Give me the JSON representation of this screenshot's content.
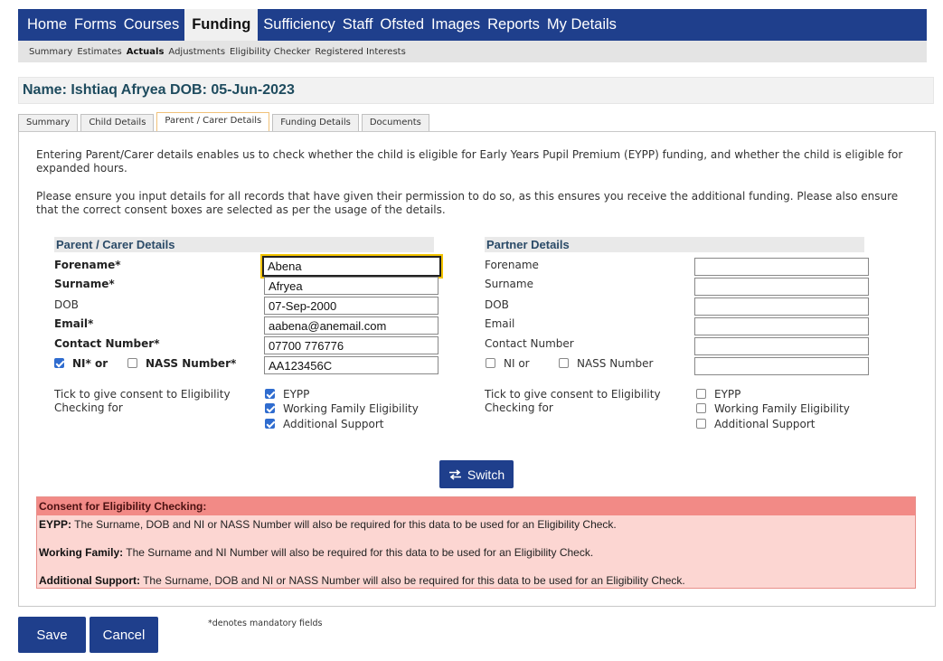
{
  "topnav": [
    "Home",
    "Forms",
    "Courses",
    "Funding",
    "Sufficiency",
    "Staff",
    "Ofsted",
    "Images",
    "Reports",
    "My Details"
  ],
  "subnav": [
    "Summary",
    "Estimates",
    "Actuals",
    "Adjustments",
    "Eligibility Checker",
    "Registered Interests"
  ],
  "name_bar": "Name: Ishtiaq Afryea DOB: 05-Jun-2023",
  "tabs": [
    "Summary",
    "Child Details",
    "Parent / Carer Details",
    "Funding Details",
    "Documents"
  ],
  "intro1": "Entering Parent/Carer details enables us to check whether the child is eligible for Early Years Pupil Premium (EYPP) funding, and whether the child is eligible for expanded hours.",
  "intro2": "Please ensure you input details for all records that have given their permission to do so, as this ensures you receive the additional funding. Please also ensure that the correct consent boxes are selected as per the usage of the details.",
  "parent": {
    "heading": "Parent / Carer Details",
    "forename_label": "Forename*",
    "surname_label": "Surname*",
    "dob_label": "DOB",
    "email_label": "Email*",
    "contact_label": "Contact Number*",
    "ni_label": "NI* or",
    "nass_label": "NASS Number*",
    "forename": "Abena",
    "surname": "Afryea",
    "dob": "07-Sep-2000",
    "email": "aabena@anemail.com",
    "contact": "07700 776776",
    "ni": "AA123456C",
    "ni_checked": true,
    "nass_checked": false,
    "consent_label": "Tick to give consent to Eligibility Checking for",
    "consent_options": [
      "EYPP",
      "Working Family Eligibility",
      "Additional Support"
    ],
    "consent_checked": [
      true,
      true,
      true
    ]
  },
  "partner": {
    "heading": "Partner Details",
    "forename_label": "Forename",
    "surname_label": "Surname",
    "dob_label": "DOB",
    "email_label": "Email",
    "contact_label": "Contact Number",
    "ni_label": "NI or",
    "nass_label": "NASS Number",
    "ni_checked": false,
    "nass_checked": false,
    "consent_label": "Tick to give consent to Eligibility Checking for",
    "consent_options": [
      "EYPP",
      "Working Family Eligibility",
      "Additional Support"
    ],
    "consent_checked": [
      false,
      false,
      false
    ]
  },
  "switch_label": "Switch",
  "consent_box": {
    "heading": "Consent for Eligibility Checking:",
    "lines": [
      {
        "key": "EYPP:",
        "text": " The Surname, DOB and NI or NASS Number will also be required for this data to be used for an Eligibility Check."
      },
      {
        "key": "Working Family:",
        "text": " The Surname and NI Number will also be required for this data to be used for an Eligibility Check."
      },
      {
        "key": "Additional Support:",
        "text": " The Surname, DOB and NI or NASS Number will also be required for this data to be used for an Eligibility Check."
      }
    ]
  },
  "save_label": "Save",
  "cancel_label": "Cancel",
  "mandatory_note": "*denotes mandatory fields",
  "colors": {
    "brand": "#1f3f8c",
    "consent_head": "#f28a86",
    "consent_bg": "#fcd6d2"
  }
}
